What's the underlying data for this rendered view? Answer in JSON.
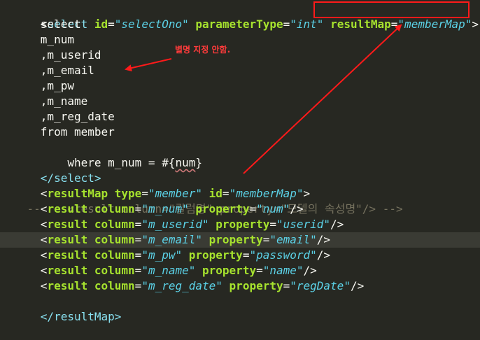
{
  "code": {
    "l1": {
      "indent": "  ",
      "open": "<",
      "tag": "select",
      "a1": "id",
      "v1": "\"selectOno\"",
      "a2": "parameterType",
      "v2": "\"int\"",
      "a3": "resultMap",
      "v3": "\"memberMap\"",
      "close": ">"
    },
    "l2": "      select",
    "l3": "      m_num",
    "l4": "      ,m_userid",
    "l5": "      ,m_email",
    "l6": "      ,m_pw",
    "l7": "      ,m_name",
    "l8": "      ,m_reg_date",
    "l9": "      from member",
    "l10": {
      "pre": "      where m_num = #{",
      "ident": "num",
      "post": "}"
    },
    "l11": {
      "indent": "  ",
      "text": "</select>"
    },
    "l12": {
      "indent": "  ",
      "open": "<",
      "tag": "resultMap",
      "a1": "type",
      "v1": "\"member\"",
      "a2": "id",
      "v2": "\"memberMap\"",
      "close": ">"
    },
    "l13": {
      "prefix": "--",
      "text": "    <result column=\"칼럼명\" property=\"모델의 속성명\"/> -->"
    },
    "rows": [
      {
        "col": "\"m_num\"",
        "prop": "\"num\""
      },
      {
        "col": "\"m_userid\"",
        "prop": "\"userid\""
      },
      {
        "col": "\"m_email\"",
        "prop": "\"email\""
      },
      {
        "col": "\"m_pw\"",
        "prop": "\"password\""
      },
      {
        "col": "\"m_name\"",
        "prop": "\"name\""
      },
      {
        "col": "\"m_reg_date\"",
        "prop": "\"regDate\""
      }
    ],
    "result_tag": "result",
    "column_attr": "column",
    "property_attr": "property",
    "close_short": "/>",
    "l20": {
      "indent": "  ",
      "text": "</resultMap>"
    }
  },
  "annotation": {
    "note": "별명 지정 안함."
  },
  "colors": {
    "background": "#272822",
    "annotation_red": "#ff1a1a"
  }
}
